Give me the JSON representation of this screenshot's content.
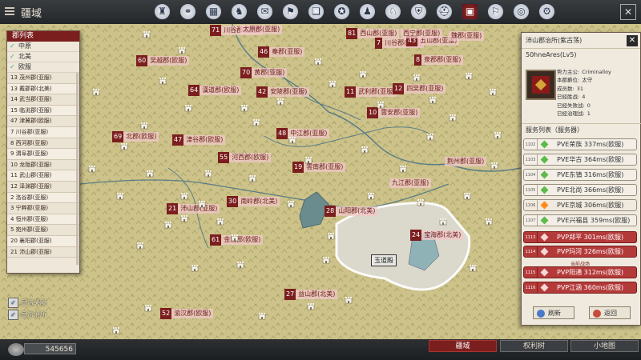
{
  "window": {
    "title": "疆域"
  },
  "toolbar": {
    "icons": [
      "castle-icon",
      "network-icon",
      "map-icon",
      "horse-icon",
      "scroll-icon",
      "banner-icon",
      "book-icon",
      "compass-icon",
      "chess-icon",
      "rider-icon",
      "armor-icon",
      "helmet-icon",
      "territory-icon",
      "flag-icon",
      "coin-icon",
      "gear-icon"
    ],
    "active_index": 12
  },
  "county_list": {
    "title": "郡列表",
    "filters": [
      "中原",
      "北美",
      "欧服"
    ],
    "rows": [
      "13 茂州郡(亚服)",
      "13 戴郡郡(北美)",
      "14 武当郡(亚服)",
      "15 临洮郡(亚服)",
      "47 津冀郡(欧服)",
      "7 川谷郡(亚服)",
      "8 西河郡(亚服)",
      "9 渭阜郡(亚服)",
      "10 龙陇郡(亚服)",
      "11 武山郡(亚服)",
      "12 泽渊郡(亚服)",
      "2 洛谷郡(亚服)",
      "3 宁粹郡(亚服)",
      "4 恒州郡(亚服)",
      "5 宛州郡(亚服)",
      "20 襄阳郡(亚服)",
      "21 沛山郡(亚服)"
    ]
  },
  "map_toggles": [
    "显示关隘",
    "显示治所"
  ],
  "map_labels": [
    {
      "num": "71",
      "name": "川谷郡(亚服)"
    },
    {
      "num": "81",
      "name": "西山郡(亚服)"
    },
    {
      "num": "7",
      "name": "川谷郡(亚服)"
    },
    {
      "num": "43",
      "name": "五山郡(亚服)"
    },
    {
      "num": "46",
      "name": "秦郡(亚服)"
    },
    {
      "num": "60",
      "name": "吴越郡(欧服)"
    },
    {
      "num": "8",
      "name": "泉郡郡(亚服)"
    },
    {
      "num": "70",
      "name": "黄郡(亚服)"
    },
    {
      "num": "64",
      "name": "漢道郡(欧服)"
    },
    {
      "num": "42",
      "name": "安陵郡(亚服)"
    },
    {
      "num": "11",
      "name": "武利郡(亚服)"
    },
    {
      "num": "12",
      "name": "四吴郡(亚服)"
    },
    {
      "num": "10",
      "name": "雲安郡(亚服)"
    },
    {
      "num": "48",
      "name": "中江郡(亚服)"
    },
    {
      "num": "69",
      "name": "北郡(欧服)"
    },
    {
      "num": "47",
      "name": "津谷郡(欧服)"
    },
    {
      "num": "55",
      "name": "河西郡(欧服)"
    },
    {
      "num": "19",
      "name": "雲南郡(亚服)"
    },
    {
      "num": "30",
      "name": "南岭郡(北美)"
    },
    {
      "num": "21",
      "name": "沛山郡(亚服)"
    },
    {
      "num": "28",
      "name": "山阳郡(北美)"
    },
    {
      "num": "61",
      "name": "金城郡(欧服)"
    },
    {
      "num": "24",
      "name": "宝海郡(北美)"
    },
    {
      "num": "27",
      "name": "益山郡(北美)"
    },
    {
      "num": "52",
      "name": "渝汉郡(欧服)"
    },
    {
      "num": "",
      "name": "九江郡(亚服)"
    },
    {
      "num": "",
      "name": "荆州郡(亚服)"
    },
    {
      "num": "",
      "name": "太原郡(亚服)"
    },
    {
      "num": "",
      "name": "西宁郡(亚服)"
    },
    {
      "num": "",
      "name": "魏郡(亚服)"
    }
  ],
  "map_special": {
    "yudao": "玉道殿"
  },
  "detail_panel": {
    "title": "沛山郡治所(紫古荡)",
    "owner": "50hneAres(Lv5)",
    "stats": [
      {
        "label": "势力主公:",
        "value": "Criminalloy"
      },
      {
        "label": "本郡爵位:",
        "value": "太守"
      },
      {
        "label": "成员数:",
        "value": "31"
      },
      {
        "label": "已经胜战:",
        "value": "4"
      },
      {
        "label": "已经失败战:",
        "value": "0"
      },
      {
        "label": "已经治理战:",
        "value": "1"
      }
    ],
    "server_list_title": "服务列表（服务器）",
    "servers": [
      {
        "id": "1102",
        "label": "PVE荣族 337ms(欧服)",
        "status": "green"
      },
      {
        "id": "1103",
        "label": "PVE华古 364ms(欧服)",
        "status": "green"
      },
      {
        "id": "1104",
        "label": "PVE东镇 316ms(欧服)",
        "status": "green"
      },
      {
        "id": "1105",
        "label": "PVE北尚 366ms(欧服)",
        "status": "green"
      },
      {
        "id": "1106",
        "label": "PVE京城 306ms(欧服)",
        "status": "orange"
      },
      {
        "id": "1107",
        "label": "PVE兴福县 359ms(欧服)",
        "status": "green"
      },
      {
        "id": "1113",
        "label": "PVP郑平 301ms(欧服)",
        "status": "red"
      },
      {
        "id": "1114",
        "label": "PVP玛河 326ms(欧服)",
        "status": "red"
      },
      {
        "id": "1115",
        "label": "PVP阳通 312ms(欧服)",
        "status": "red"
      },
      {
        "id": "1116",
        "label": "PVP江涵 360ms(欧服)",
        "status": "red"
      }
    ],
    "divider": "当前战场",
    "refresh": "刷新",
    "back": "返回"
  },
  "bottom": {
    "currency": "545656",
    "tabs": [
      "疆域",
      "权利树",
      "小地图"
    ],
    "active_tab": 0
  },
  "colors": {
    "accent": "#7b1e1e",
    "map_land": "#c9bf86",
    "river": "#5a7d85",
    "green_status": "#5dbb4a",
    "orange_status": "#ff8a1a"
  }
}
